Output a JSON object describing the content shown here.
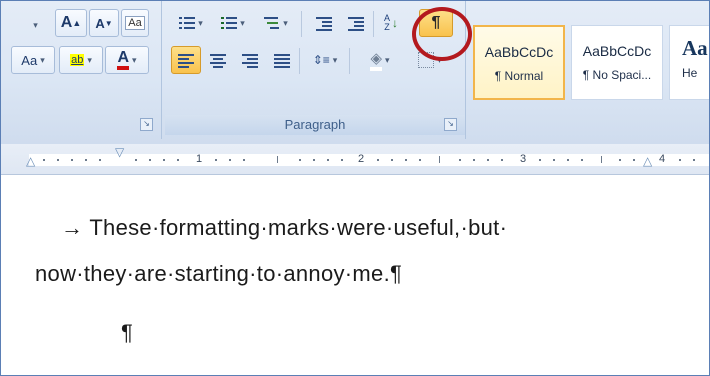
{
  "font_group": {
    "grow_font": "A",
    "shrink_font": "A",
    "change_case": "Aa",
    "highlight_sample": "ab",
    "font_color_sample": "A"
  },
  "paragraph_group": {
    "label": "Paragraph",
    "sort_label": "A Z",
    "show_hide_symbol": "¶"
  },
  "styles": [
    {
      "sample": "AaBbCcDc",
      "name": "¶ Normal",
      "active": true
    },
    {
      "sample": "AaBbCcDc",
      "name": "¶ No Spaci...",
      "active": false
    },
    {
      "sample": "Aa",
      "name": "He",
      "active": false
    }
  ],
  "ruler": {
    "numbers": [
      "1",
      "2",
      "3",
      "4"
    ]
  },
  "document": {
    "line1": "→  These·formatting·marks·were·useful,·but·",
    "line2": "now·they·are·starting·to·annoy·me.¶",
    "line3": "¶"
  },
  "colors": {
    "highlight_circle": "#b3191e",
    "pilcrow_active_bg": "#f9c24d",
    "font_color_red": "#d01010",
    "highlight_yellow": "#ffff00"
  }
}
